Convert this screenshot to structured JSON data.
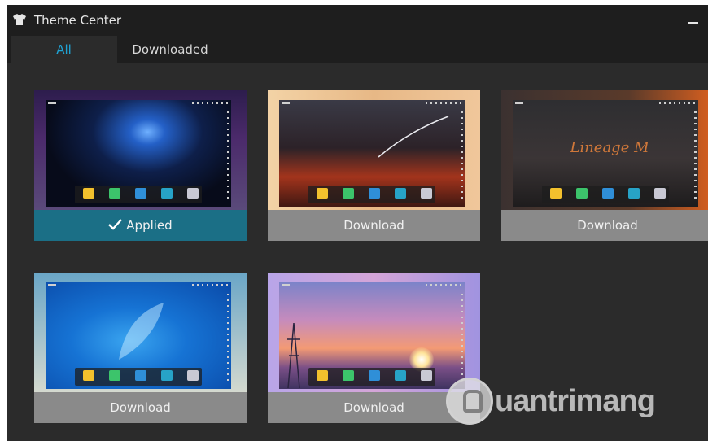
{
  "window": {
    "title": "Theme Center",
    "title_icon": "shirt-icon",
    "minimize_icon": "minimize-icon"
  },
  "tabs": [
    {
      "label": "All",
      "active": true
    },
    {
      "label": "Downloaded",
      "active": false
    }
  ],
  "themes": [
    {
      "button_label": "Applied",
      "status": "applied",
      "artwork_text": ""
    },
    {
      "button_label": "Download",
      "status": "available",
      "artwork_text": ""
    },
    {
      "button_label": "Download",
      "status": "available",
      "artwork_text": "Lineage M"
    },
    {
      "button_label": "Download",
      "status": "available",
      "artwork_text": ""
    },
    {
      "button_label": "Download",
      "status": "available",
      "artwork_text": ""
    }
  ],
  "watermark": {
    "text": "uantrimang"
  },
  "colors": {
    "active_tab_text": "#1fa3d4",
    "applied_button": "#1b6f86",
    "download_button": "#8a8a8a",
    "window_bg": "#2b2b2b",
    "titlebar_bg": "#1e1e1e"
  }
}
